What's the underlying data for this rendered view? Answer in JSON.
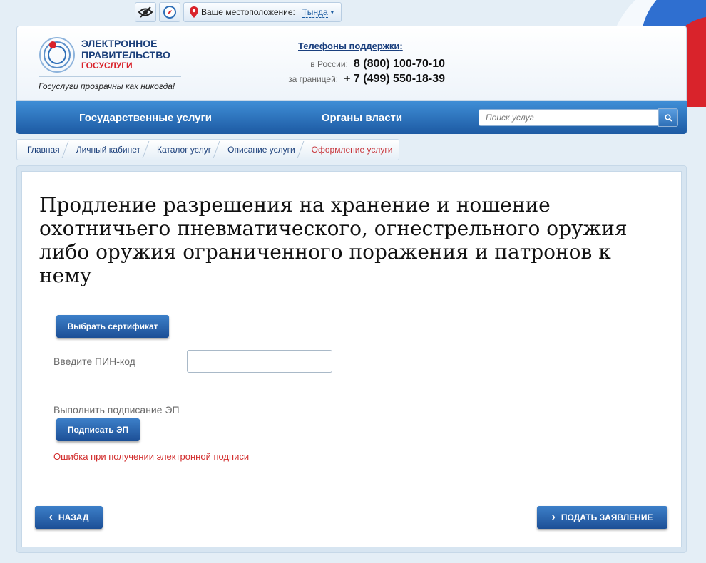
{
  "topbar": {
    "location_label": "Ваше местоположение:",
    "city": "Тында"
  },
  "header": {
    "logo_line1": "ЭЛЕКТРОННОЕ",
    "logo_line2": "ПРАВИТЕЛЬСТВО",
    "logo_line3": "ГОСУСЛУГИ",
    "tagline": "Госуслуги прозрачны как никогда!",
    "phones": {
      "title": "Телефоны поддержки",
      "russia_label": "в России:",
      "russia_number": "8 (800) 100-70-10",
      "abroad_label": "за границей:",
      "abroad_number": "+ 7 (499) 550-18-39"
    }
  },
  "nav": {
    "items": [
      "Государственные услуги",
      "Органы власти"
    ],
    "search_placeholder": "Поиск услуг"
  },
  "breadcrumb": [
    "Главная",
    "Личный кабинет",
    "Каталог услуг",
    "Описание услуги",
    "Оформление услуги"
  ],
  "main": {
    "title": "Продление разрешения на хранение и ношение охотничьего пневматического, огнестрельного оружия либо оружия ограниченного поражения и патронов к нему",
    "choose_cert_button": "Выбрать сертификат",
    "pin_label": "Введите ПИН-код",
    "pin_value": "",
    "sign_label": "Выполнить подписание ЭП",
    "sign_button": "Подписать ЭП",
    "error_text": "Ошибка при получении электронной подписи",
    "back_button": "НАЗАД",
    "submit_button": "ПОДАТЬ ЗАЯВЛЕНИЕ"
  },
  "colors": {
    "brand_blue": "#1d5aa3",
    "accent_red": "#d9232b",
    "error_red": "#d22d2d"
  },
  "icons": [
    "low-vision-icon",
    "compass-icon",
    "location-pin-icon",
    "dropdown-caret-icon",
    "search-icon",
    "chevron-left-icon",
    "chevron-right-icon"
  ]
}
